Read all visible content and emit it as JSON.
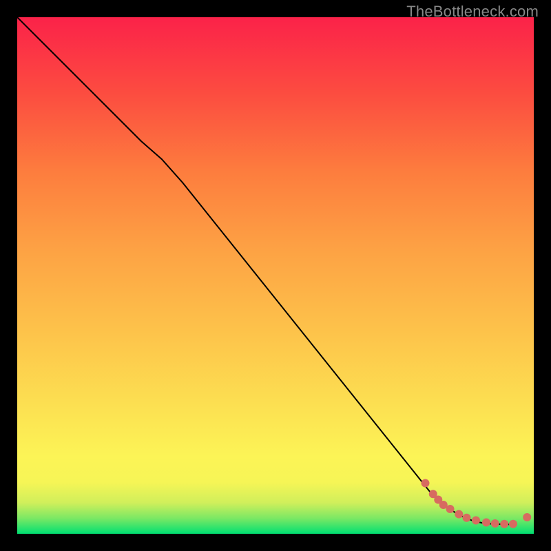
{
  "watermark": "TheBottleneck.com",
  "chart_data": {
    "type": "line",
    "title": "",
    "xlabel": "",
    "ylabel": "",
    "xlim": [
      0,
      100
    ],
    "ylim": [
      0,
      100
    ],
    "gradient": {
      "stops": [
        {
          "offset": 0,
          "color": "#00e072"
        },
        {
          "offset": 0.03,
          "color": "#7be864"
        },
        {
          "offset": 0.06,
          "color": "#d0ef5b"
        },
        {
          "offset": 0.1,
          "color": "#f6f556"
        },
        {
          "offset": 0.15,
          "color": "#fcf456"
        },
        {
          "offset": 0.4,
          "color": "#fdc14a"
        },
        {
          "offset": 0.55,
          "color": "#fda244"
        },
        {
          "offset": 0.7,
          "color": "#fd7d3e"
        },
        {
          "offset": 0.85,
          "color": "#fc4d40"
        },
        {
          "offset": 1.0,
          "color": "#fb2249"
        }
      ]
    },
    "series": [
      {
        "name": "curve",
        "color": "#000000",
        "stroke_width": 2,
        "x": [
          0,
          4,
          8,
          12,
          16,
          20,
          24,
          28,
          32,
          36,
          40,
          44,
          48,
          52,
          56,
          60,
          64,
          68,
          72,
          76,
          80,
          82,
          84,
          86,
          88,
          90,
          92,
          94,
          96
        ],
        "y": [
          100,
          96,
          92,
          88,
          84,
          80,
          76,
          72.5,
          68,
          63,
          58,
          53,
          48,
          43,
          38,
          33,
          28,
          23,
          18,
          13,
          8,
          6.2,
          4.6,
          3.4,
          2.6,
          2.1,
          1.9,
          1.85,
          1.8
        ]
      }
    ],
    "markers": {
      "name": "bottleneck-points",
      "color": "#d76b60",
      "radius": 6,
      "points": [
        {
          "x": 79.0,
          "y": 9.8
        },
        {
          "x": 80.5,
          "y": 7.7
        },
        {
          "x": 81.5,
          "y": 6.6
        },
        {
          "x": 82.5,
          "y": 5.6
        },
        {
          "x": 83.8,
          "y": 4.8
        },
        {
          "x": 85.5,
          "y": 3.8
        },
        {
          "x": 87.0,
          "y": 3.1
        },
        {
          "x": 88.8,
          "y": 2.6
        },
        {
          "x": 90.8,
          "y": 2.2
        },
        {
          "x": 92.5,
          "y": 2.0
        },
        {
          "x": 94.3,
          "y": 1.9
        },
        {
          "x": 96.0,
          "y": 1.9
        },
        {
          "x": 98.7,
          "y": 3.2
        }
      ]
    }
  }
}
